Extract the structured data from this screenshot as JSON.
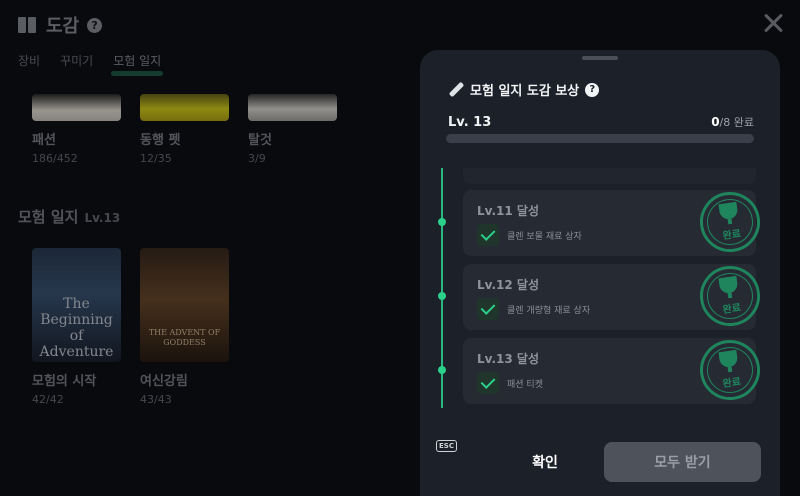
{
  "header": {
    "title": "도감",
    "help": "?"
  },
  "tabs": [
    {
      "label": "장비"
    },
    {
      "label": "꾸미기"
    },
    {
      "label": "모험 일지"
    }
  ],
  "collections": [
    {
      "name": "패션",
      "count": "186/452"
    },
    {
      "name": "동행 펫",
      "count": "12/35"
    },
    {
      "name": "탈것",
      "count": "3/9"
    }
  ],
  "journal_section": {
    "title": "모험 일지",
    "level": "Lv.13"
  },
  "journals": [
    {
      "name": "모험의 시작",
      "count": "42/42",
      "cover_text": "The Beginning of Adventure"
    },
    {
      "name": "여신강림",
      "count": "43/43",
      "cover_text": "THE ADVENT OF GODDESS"
    }
  ],
  "modal": {
    "title": "모험 일지 도감 보상",
    "help": "?",
    "level_label": "Lv. 13",
    "progress_done": "0",
    "progress_total": "/8 완료",
    "progress_fraction": 0,
    "rewards": [
      {
        "title": "Lv.11 달성",
        "item": "클렌 보물 재료 상자",
        "stamp": "완료"
      },
      {
        "title": "Lv.12 달성",
        "item": "클렌 개량형 재료 상자",
        "stamp": "완료"
      },
      {
        "title": "Lv.13 달성",
        "item": "패션 티켓",
        "stamp": "완료"
      }
    ],
    "esc_key": "ESC",
    "confirm_label": "확인",
    "claim_all_label": "모두 받기"
  },
  "colors": {
    "accent": "#2bd188",
    "panel": "#1c2028",
    "item_bg": "#252a33",
    "disabled_button": "#4d525b"
  }
}
